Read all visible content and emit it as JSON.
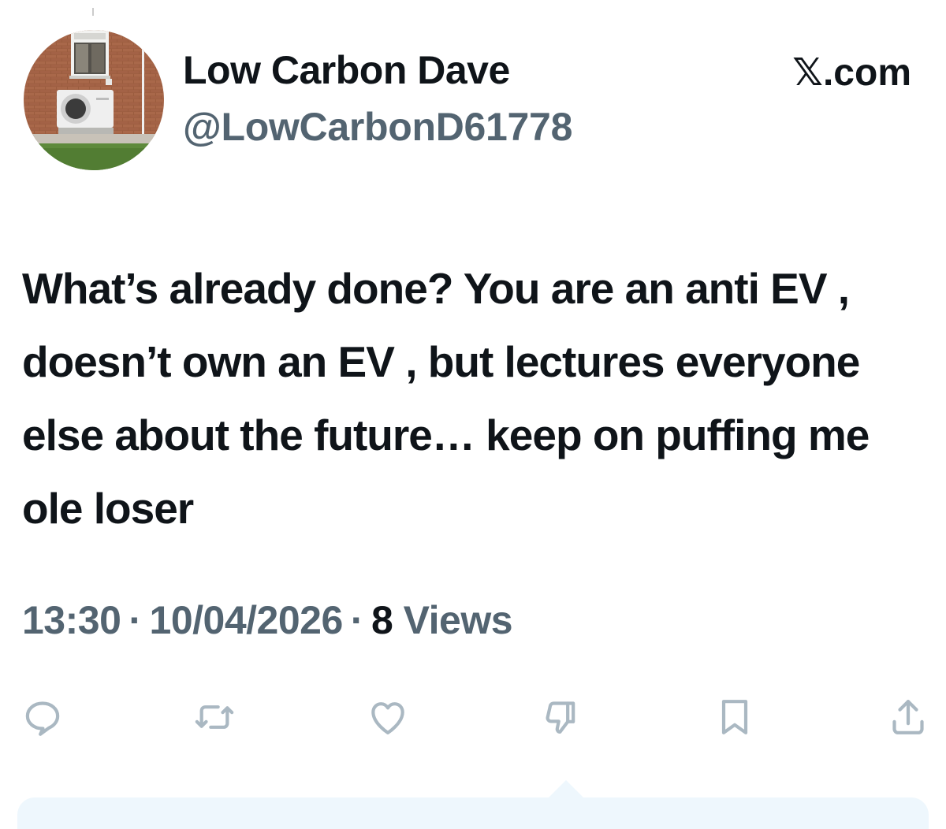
{
  "profile": {
    "display_name": "Low Carbon Dave",
    "handle": "@LowCarbonD61778"
  },
  "brand": {
    "label": "𝕏.com"
  },
  "tweet": {
    "text": "What’s already done? You are an anti EV , doesn’t own an EV , but lectures everyone else about the future… keep on puffing me ole loser",
    "time": "13:30",
    "date": "10/04/2026",
    "separator": "·",
    "views_count": "8",
    "views_label": "Views"
  },
  "actions": [
    {
      "name": "reply",
      "icon": "speech-bubble-icon"
    },
    {
      "name": "repost",
      "icon": "repost-arrows-icon"
    },
    {
      "name": "like",
      "icon": "heart-icon"
    },
    {
      "name": "dislike",
      "icon": "thumbs-down-icon"
    },
    {
      "name": "bookmark",
      "icon": "bookmark-icon"
    },
    {
      "name": "share",
      "icon": "share-upload-icon"
    }
  ],
  "colors": {
    "text_primary": "#0f1419",
    "text_secondary": "#536471",
    "icon_muted": "#aab8c2",
    "reply_background": "#eef7fd"
  }
}
